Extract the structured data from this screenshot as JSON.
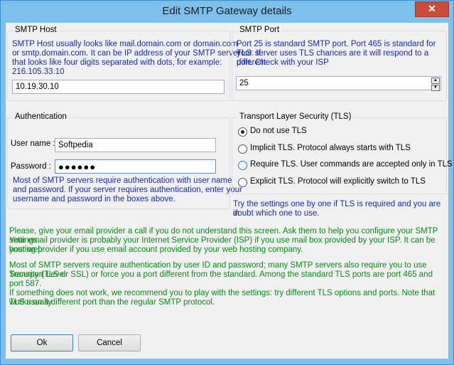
{
  "window": {
    "title": "Edit SMTP Gateway details",
    "close_symbol": "✕"
  },
  "smtp_host": {
    "group_label": "SMTP Host",
    "help": [
      "SMTP Host usually looks like mail.domain.com or domain.com",
      "or smtp.domain.com. It can be IP address of your SMTP server",
      "that looks like four digits separated with dots, for example:",
      "216.105.33.10"
    ],
    "value": "10.19.30.10"
  },
  "smtp_port": {
    "group_label": "SMTP Port",
    "help": [
      "Port 25 is standard SMTP port. Port 465 is standard for TLS. If",
      "your server uses TLS chances are it will respond to a different",
      "port. Check with your ISP"
    ],
    "value": "25"
  },
  "auth": {
    "group_label": "Authentication",
    "username_label": "User name :",
    "username_value": "Softpedia",
    "password_label": "Password :",
    "password_value": "●●●●●●",
    "help": [
      "Most of SMTP servers require authentication with user name",
      "and password. If your server requires authentication, enter your",
      "username and password in the boxes above."
    ]
  },
  "tls": {
    "group_label": "Transport Layer Security (TLS)",
    "options": [
      {
        "label": "Do not use TLS",
        "checked": true
      },
      {
        "label": "Implicit TLS. Protocol always starts with TLS",
        "checked": false
      },
      {
        "label": "Require TLS. User commands are accepted only in TLS",
        "checked": false
      },
      {
        "label": "Explicit TLS. Protocol will explicitly switch to TLS",
        "checked": false
      }
    ],
    "hint": [
      "Try the settings one by one if TLS is required and you are in",
      "doubt which one to use."
    ]
  },
  "notes": [
    "Please, give your email provider a call if you do not understand this screen. Ask them to help you configure your SMTP settings.",
    "Your email provider is probably your Internet Service Provider (ISP) if you use mail box provided by your ISP. It can be your web",
    "hosting provider if you use email account provided by your web hosting company.",
    "",
    "Most of SMTP servers require authentication by user ID and password; many SMTP servers also require you to use Transport Level",
    "Security (TLS or SSL) or force you a port different from the standard. Among the standard TLS ports are port 465 and port 587.",
    "",
    "If something does not work, we recommend you to play with the settings: try different TLS options and ports. Note that TLS usually",
    "works on a different port than the regular SMTP protocol."
  ],
  "buttons": {
    "ok": "Ok",
    "cancel": "Cancel"
  },
  "colors": {
    "help_text": "#1a2bb0",
    "notes_text": "#0a8a1a",
    "title_bar": "#7ec0ec",
    "close": "#c94b3c"
  }
}
